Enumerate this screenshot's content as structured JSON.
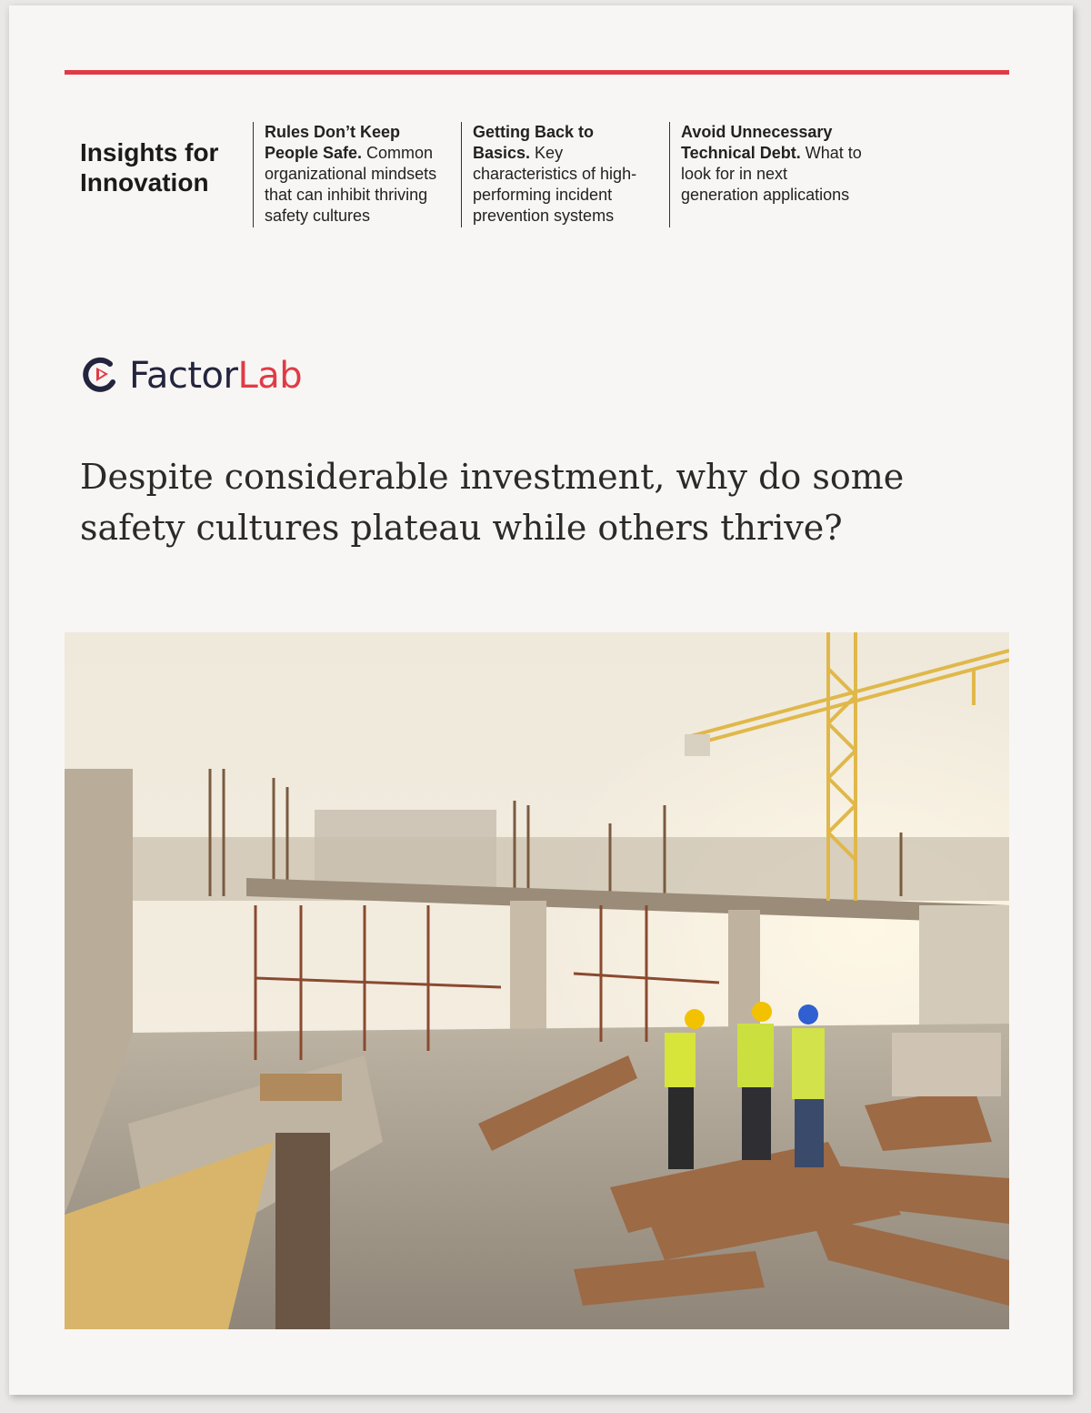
{
  "header": {
    "series_title": "Insights for Innovation",
    "columns": [
      {
        "bold": "Rules Don’t Keep People Safe.",
        "text": " Common organizational mindsets that can inhibit thriving safety cultures"
      },
      {
        "bold": "Getting Back to Basics.",
        "text": " Key characteristics of high-performing incident prevention systems"
      },
      {
        "bold": "Avoid Unnecessary Technical Debt.",
        "text": " What to look for in next generation applications"
      }
    ]
  },
  "brand": {
    "name_part1": "Factor",
    "name_part2": "Lab",
    "icon": "factorlab-logo-icon",
    "colors": {
      "accent": "#e03b45",
      "navy": "#23253f"
    }
  },
  "headline": "Despite considerable investment, why do some safety cultures plateau while others thrive?",
  "photo": {
    "icon": "construction-site-photo"
  }
}
